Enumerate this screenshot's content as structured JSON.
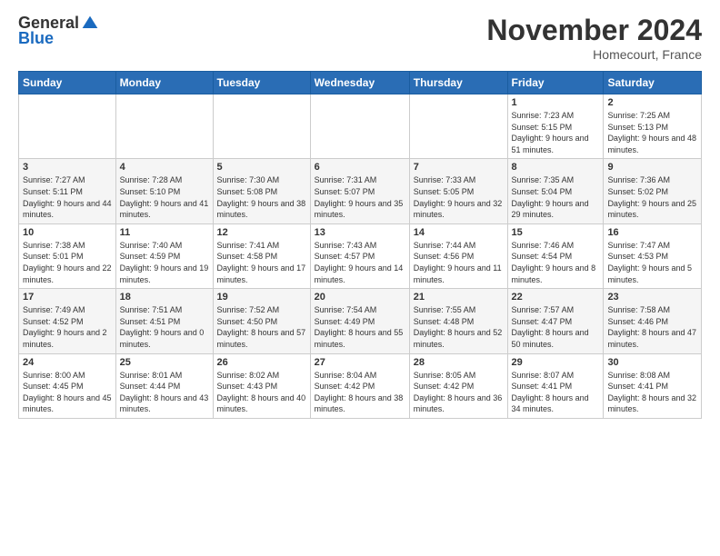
{
  "logo": {
    "general": "General",
    "blue": "Blue"
  },
  "title": "November 2024",
  "subtitle": "Homecourt, France",
  "days_header": [
    "Sunday",
    "Monday",
    "Tuesday",
    "Wednesday",
    "Thursday",
    "Friday",
    "Saturday"
  ],
  "weeks": [
    [
      {
        "day": "",
        "info": ""
      },
      {
        "day": "",
        "info": ""
      },
      {
        "day": "",
        "info": ""
      },
      {
        "day": "",
        "info": ""
      },
      {
        "day": "",
        "info": ""
      },
      {
        "day": "1",
        "info": "Sunrise: 7:23 AM\nSunset: 5:15 PM\nDaylight: 9 hours and 51 minutes."
      },
      {
        "day": "2",
        "info": "Sunrise: 7:25 AM\nSunset: 5:13 PM\nDaylight: 9 hours and 48 minutes."
      }
    ],
    [
      {
        "day": "3",
        "info": "Sunrise: 7:27 AM\nSunset: 5:11 PM\nDaylight: 9 hours and 44 minutes."
      },
      {
        "day": "4",
        "info": "Sunrise: 7:28 AM\nSunset: 5:10 PM\nDaylight: 9 hours and 41 minutes."
      },
      {
        "day": "5",
        "info": "Sunrise: 7:30 AM\nSunset: 5:08 PM\nDaylight: 9 hours and 38 minutes."
      },
      {
        "day": "6",
        "info": "Sunrise: 7:31 AM\nSunset: 5:07 PM\nDaylight: 9 hours and 35 minutes."
      },
      {
        "day": "7",
        "info": "Sunrise: 7:33 AM\nSunset: 5:05 PM\nDaylight: 9 hours and 32 minutes."
      },
      {
        "day": "8",
        "info": "Sunrise: 7:35 AM\nSunset: 5:04 PM\nDaylight: 9 hours and 29 minutes."
      },
      {
        "day": "9",
        "info": "Sunrise: 7:36 AM\nSunset: 5:02 PM\nDaylight: 9 hours and 25 minutes."
      }
    ],
    [
      {
        "day": "10",
        "info": "Sunrise: 7:38 AM\nSunset: 5:01 PM\nDaylight: 9 hours and 22 minutes."
      },
      {
        "day": "11",
        "info": "Sunrise: 7:40 AM\nSunset: 4:59 PM\nDaylight: 9 hours and 19 minutes."
      },
      {
        "day": "12",
        "info": "Sunrise: 7:41 AM\nSunset: 4:58 PM\nDaylight: 9 hours and 17 minutes."
      },
      {
        "day": "13",
        "info": "Sunrise: 7:43 AM\nSunset: 4:57 PM\nDaylight: 9 hours and 14 minutes."
      },
      {
        "day": "14",
        "info": "Sunrise: 7:44 AM\nSunset: 4:56 PM\nDaylight: 9 hours and 11 minutes."
      },
      {
        "day": "15",
        "info": "Sunrise: 7:46 AM\nSunset: 4:54 PM\nDaylight: 9 hours and 8 minutes."
      },
      {
        "day": "16",
        "info": "Sunrise: 7:47 AM\nSunset: 4:53 PM\nDaylight: 9 hours and 5 minutes."
      }
    ],
    [
      {
        "day": "17",
        "info": "Sunrise: 7:49 AM\nSunset: 4:52 PM\nDaylight: 9 hours and 2 minutes."
      },
      {
        "day": "18",
        "info": "Sunrise: 7:51 AM\nSunset: 4:51 PM\nDaylight: 9 hours and 0 minutes."
      },
      {
        "day": "19",
        "info": "Sunrise: 7:52 AM\nSunset: 4:50 PM\nDaylight: 8 hours and 57 minutes."
      },
      {
        "day": "20",
        "info": "Sunrise: 7:54 AM\nSunset: 4:49 PM\nDaylight: 8 hours and 55 minutes."
      },
      {
        "day": "21",
        "info": "Sunrise: 7:55 AM\nSunset: 4:48 PM\nDaylight: 8 hours and 52 minutes."
      },
      {
        "day": "22",
        "info": "Sunrise: 7:57 AM\nSunset: 4:47 PM\nDaylight: 8 hours and 50 minutes."
      },
      {
        "day": "23",
        "info": "Sunrise: 7:58 AM\nSunset: 4:46 PM\nDaylight: 8 hours and 47 minutes."
      }
    ],
    [
      {
        "day": "24",
        "info": "Sunrise: 8:00 AM\nSunset: 4:45 PM\nDaylight: 8 hours and 45 minutes."
      },
      {
        "day": "25",
        "info": "Sunrise: 8:01 AM\nSunset: 4:44 PM\nDaylight: 8 hours and 43 minutes."
      },
      {
        "day": "26",
        "info": "Sunrise: 8:02 AM\nSunset: 4:43 PM\nDaylight: 8 hours and 40 minutes."
      },
      {
        "day": "27",
        "info": "Sunrise: 8:04 AM\nSunset: 4:42 PM\nDaylight: 8 hours and 38 minutes."
      },
      {
        "day": "28",
        "info": "Sunrise: 8:05 AM\nSunset: 4:42 PM\nDaylight: 8 hours and 36 minutes."
      },
      {
        "day": "29",
        "info": "Sunrise: 8:07 AM\nSunset: 4:41 PM\nDaylight: 8 hours and 34 minutes."
      },
      {
        "day": "30",
        "info": "Sunrise: 8:08 AM\nSunset: 4:41 PM\nDaylight: 8 hours and 32 minutes."
      }
    ]
  ]
}
